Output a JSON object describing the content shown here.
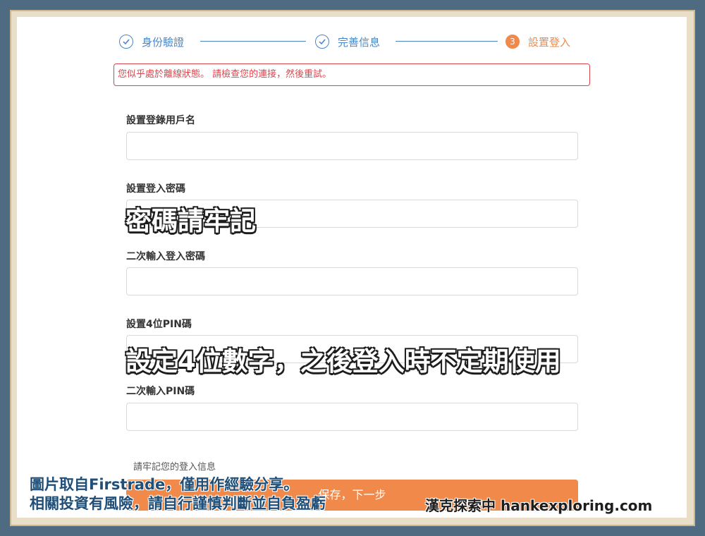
{
  "steps": [
    {
      "label": "身份驗證",
      "state": "done"
    },
    {
      "label": "完善信息",
      "state": "done"
    },
    {
      "label": "設置登入",
      "number": "3",
      "state": "active"
    }
  ],
  "error_message": "您似乎處於離線狀態。 請檢查您的連接，然後重試。",
  "form": {
    "username_label": "設置登錄用戶名",
    "password_label": "設置登入密碼",
    "password_confirm_label": "二次輸入登入密碼",
    "pin_label": "設置4位PIN碼",
    "pin_confirm_label": "二次輸入PIN碼",
    "remember_note": "請牢記您的登入信息",
    "submit_label": "保存，下一步"
  },
  "overlays": {
    "password_tip": "密碼請牢記",
    "pin_tip": "設定4位數字，之後登入時不定期使用"
  },
  "footer": {
    "disclaimer_line1": "圖片取自Firstrade，僅用作經驗分享。",
    "disclaimer_line2": "相關投資有風險，請自行謹慎判斷並自負盈虧",
    "brand": "漢克探索中 hankexploring.com"
  },
  "colors": {
    "accent": "#f0894a",
    "step_blue": "#4a86c6",
    "error": "#d8464e",
    "frame": "#4f6b82"
  }
}
